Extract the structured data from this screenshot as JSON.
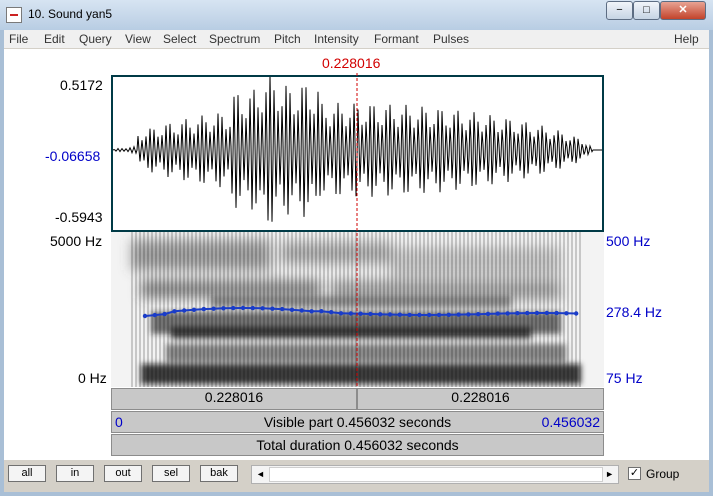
{
  "window": {
    "title": "10. Sound yan5",
    "minimize": "−",
    "maximize": "□",
    "close": "✕"
  },
  "menu": [
    "File",
    "Edit",
    "Query",
    "View",
    "Select",
    "Spectrum",
    "Pitch",
    "Intensity",
    "Formant",
    "Pulses",
    "Help"
  ],
  "cursor_time": "0.228016",
  "waveform": {
    "max_label": "0.5172",
    "cursor_value": "-0.06658",
    "min_label": "-0.5943"
  },
  "spectrogram": {
    "top_freq": "5000 Hz",
    "bottom_freq": "0 Hz",
    "pitch_top": "500 Hz",
    "pitch_current": "278.4 Hz",
    "pitch_bottom": "75 Hz"
  },
  "bars": {
    "left_segment": "0.228016",
    "right_segment": "0.228016",
    "visible_start": "0",
    "visible_text": "Visible part 0.456032 seconds",
    "visible_end": "0.456032",
    "total_text": "Total duration 0.456032 seconds"
  },
  "buttons": {
    "all": "all",
    "in": "in",
    "out": "out",
    "sel": "sel",
    "bak": "bak"
  },
  "scroll": {
    "left_arrow": "◄",
    "right_arrow": "►"
  },
  "group": {
    "label": "Group",
    "checked": "✓"
  },
  "colors": {
    "pitch_line": "#1a3cc8",
    "cursor": "#d20000",
    "title_bar": "#c8d8ea"
  }
}
